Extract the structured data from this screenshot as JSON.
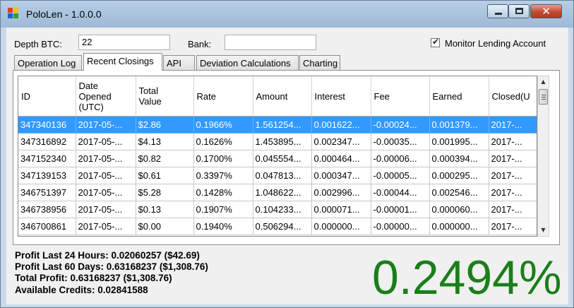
{
  "window": {
    "title": "PoloLen - 1.0.0.0",
    "close_glyph": "✕"
  },
  "form": {
    "depth_label": "Depth BTC:",
    "depth_value": "22",
    "bank_label": "Bank:",
    "bank_value": "",
    "monitor_label": "Monitor Lending Account",
    "monitor_checked": true,
    "check_glyph": "✔"
  },
  "tabs": [
    {
      "label": "Operation Log"
    },
    {
      "label": "Recent Closings"
    },
    {
      "label": "API"
    },
    {
      "label": "Deviation Calculations"
    },
    {
      "label": "Charting"
    }
  ],
  "grid": {
    "columns": [
      "ID",
      "Date\nOpened\n(UTC)",
      "Total\nValue",
      "Rate",
      "Amount",
      "Interest",
      "Fee",
      "Earned",
      "Closed(U"
    ],
    "rows": [
      [
        "347340136",
        "2017-05-...",
        "$2.86",
        "0.1966%",
        "1.561254...",
        "0.001622...",
        "-0.00024...",
        "0.001379...",
        "2017-..."
      ],
      [
        "347316892",
        "2017-05-...",
        "$4.13",
        "0.1626%",
        "1.453895...",
        "0.002347...",
        "-0.00035...",
        "0.001995...",
        "2017-..."
      ],
      [
        "347152340",
        "2017-05-...",
        "$0.82",
        "0.1700%",
        "0.045554...",
        "0.000464...",
        "-0.00006...",
        "0.000394...",
        "2017-..."
      ],
      [
        "347139153",
        "2017-05-...",
        "$0.61",
        "0.3397%",
        "0.047813...",
        "0.000347...",
        "-0.00005...",
        "0.000295...",
        "2017-..."
      ],
      [
        "346751397",
        "2017-05-...",
        "$5.28",
        "0.1428%",
        "1.048622...",
        "0.002996...",
        "-0.00044...",
        "0.002546...",
        "2017-..."
      ],
      [
        "346738956",
        "2017-05-...",
        "$0.13",
        "0.1907%",
        "0.104233...",
        "0.000071...",
        "-0.00001...",
        "0.000060...",
        "2017-..."
      ],
      [
        "346700861",
        "2017-05-...",
        "$0.00",
        "0.1940%",
        "0.506294...",
        "0.000000...",
        "-0.00000...",
        "0.000000...",
        "2017-..."
      ]
    ],
    "selected_row": 0,
    "scroll_up": "▲",
    "scroll_down": "▼"
  },
  "stats": {
    "profit_24h": "Profit Last 24 Hours:  0.02060257 ($42.69)",
    "profit_60d": "Profit Last 60 Days: 0.63168237 ($1,308.76)",
    "total_profit": "Total Profit: 0.63168237 ($1,308.76)",
    "available_credits": "Available Credits:  0.02841588"
  },
  "big_rate": "0.2494%",
  "colors": {
    "selection": "#3399ff",
    "big_rate": "#1a7f1a"
  }
}
